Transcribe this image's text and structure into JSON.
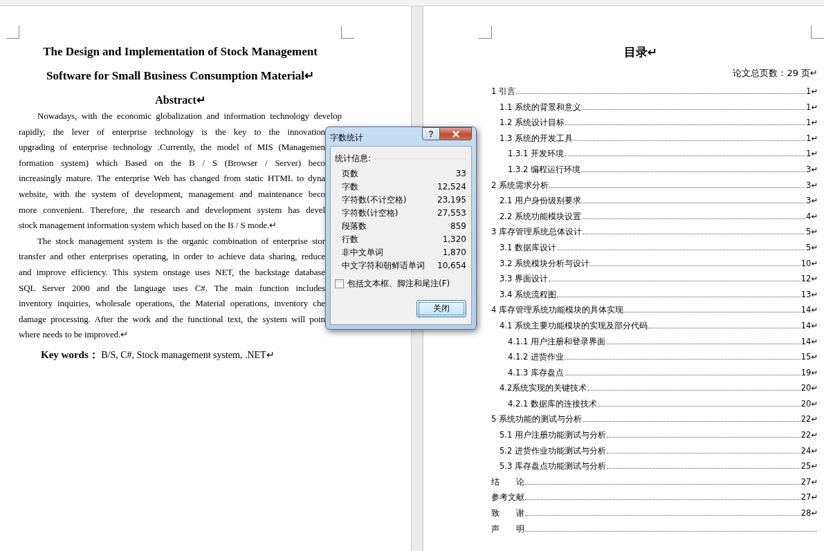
{
  "left_page": {
    "title_lines": [
      "The Design and Implementation of Stock Management",
      "Software for Small Business Consumption Material↵"
    ],
    "heading": "Abstract↵",
    "lines": [
      {
        "text": "Nowadays, with the economic globalization and information technology develop",
        "kind": "first"
      },
      {
        "text": "rapidly, the lever of enterprise technology is the key to the innovation",
        "kind": "cut"
      },
      {
        "text": "upgrading of enterprise technology .Currently, the model of MIS (Managemen",
        "kind": "cut"
      },
      {
        "text": "formation system) which Based on the B / S (Browser / Server)  beco",
        "kind": "cut"
      },
      {
        "text": "increasingly mature. The enterprise Web has changed from static HTML to dyna",
        "kind": "cut"
      },
      {
        "text": "website, with the system of development, management and maintenance beco",
        "kind": "cut"
      },
      {
        "text": "more convenient. Therefore, the research and development system has devel",
        "kind": "cut"
      },
      {
        "text": "stock management information system which based on the B / S mode.↵",
        "kind": "last"
      },
      {
        "text": "The stock management system is the organic combination of enterprise stor",
        "kind": "firstcut"
      },
      {
        "text": "transfer and other enterprises operating, in order to achieve data sharing, reduce",
        "kind": "cut"
      },
      {
        "text": "and improve efficiency. This system onstage uses NET, the backstage database",
        "kind": "cut"
      },
      {
        "text": "SQL Server 2000 and the language uses C#. The main function includes",
        "kind": "cut"
      },
      {
        "text": "inventory inquiries, wholesale operations, the Material operations, inventory che",
        "kind": "cut"
      },
      {
        "text": "damage processing. After the work and the functional text, the system will poin",
        "kind": "cut"
      },
      {
        "text": "where needs to be improved.↵",
        "kind": "last"
      }
    ],
    "keywords": "**Key words：** B/S, C#, Stock management system, .NET↵"
  },
  "right_page": {
    "title": "目录↵",
    "total_pages": "论文总页数：29 页↵",
    "toc": [
      {
        "label": "1 引言",
        "page": "1↵",
        "children": [
          {
            "label": "1.1 系统的背景和意义",
            "page": "1↵"
          },
          {
            "label": "1.2 系统设计目标",
            "page": "1↵"
          },
          {
            "label": "1.3 系统的开发工具",
            "page": "1↵",
            "children": [
              {
                "label": "1.3.1 开发环境",
                "page": "1↵"
              },
              {
                "label": "1.3.2 编程运行环境",
                "page": "3↵"
              }
            ]
          }
        ]
      },
      {
        "label": "2 系统需求分析",
        "page": "3↵",
        "children": [
          {
            "label": "2.1 用户身份级别要求",
            "page": "3↵"
          },
          {
            "label": "2.2 系统功能模块设置",
            "page": "4↵"
          }
        ]
      },
      {
        "label": "3 库存管理系统总体设计",
        "page": "5↵",
        "children": [
          {
            "label": "3.1 数据库设计",
            "page": "5↵"
          },
          {
            "label": "3.2 系统模块分析与设计",
            "page": "10↵"
          },
          {
            "label": "3.3 界面设计",
            "page": "12↵"
          },
          {
            "label": "3.4 系统流程图",
            "page": "13↵"
          }
        ]
      },
      {
        "label": "4 库存管理系统功能模块的具体实现",
        "page": "14↵",
        "children": [
          {
            "label": "4.1 系统主要功能模块的实现及部分代码",
            "page": "14↵",
            "children": [
              {
                "label": "4.1.1 用户注册和登录界面",
                "page": "14↵"
              },
              {
                "label": "4.1.2 进货作业",
                "page": "15↵"
              },
              {
                "label": "4.1.3 库存盘点",
                "page": "19↵"
              }
            ]
          },
          {
            "label": "4.2系统实现的关键技术",
            "page": "20↵",
            "children": [
              {
                "label": "4.2.1 数据库的连接技术",
                "page": "20↵"
              }
            ]
          }
        ]
      },
      {
        "label": "5 系统功能的测试与分析",
        "page": "22↵",
        "children": [
          {
            "label": "5.1 用户注册功能测试与分析",
            "page": "22↵"
          },
          {
            "label": "5.2 进货作业功能测试与分析",
            "page": "24↵"
          },
          {
            "label": "5.3 库存盘点功能测试与分析",
            "page": "25↵"
          }
        ]
      },
      {
        "label": "结　　论",
        "page": "27↵"
      },
      {
        "label": "参考文献",
        "page": "27↵"
      },
      {
        "label": "致　　谢",
        "page": "28↵"
      },
      {
        "label": "声　　明"
      }
    ]
  },
  "dialog": {
    "title": "字数统计",
    "help": "?",
    "group_label": "统计信息:",
    "stats": [
      {
        "label": "页数",
        "value": "33"
      },
      {
        "label": "字数",
        "value": "12,524"
      },
      {
        "label": "字符数(不计空格)",
        "value": "23,195"
      },
      {
        "label": "字符数(计空格)",
        "value": "27,553"
      },
      {
        "label": "段落数",
        "value": "859"
      },
      {
        "label": "行数",
        "value": "1,320"
      },
      {
        "label": "非中文单词",
        "value": "1,870"
      },
      {
        "label": "中文字符和朝鲜语单词",
        "value": "10,654"
      }
    ],
    "checkbox": {
      "label": "包括文本框、脚注和尾注(F)",
      "checked": false
    },
    "button": "关闭"
  }
}
